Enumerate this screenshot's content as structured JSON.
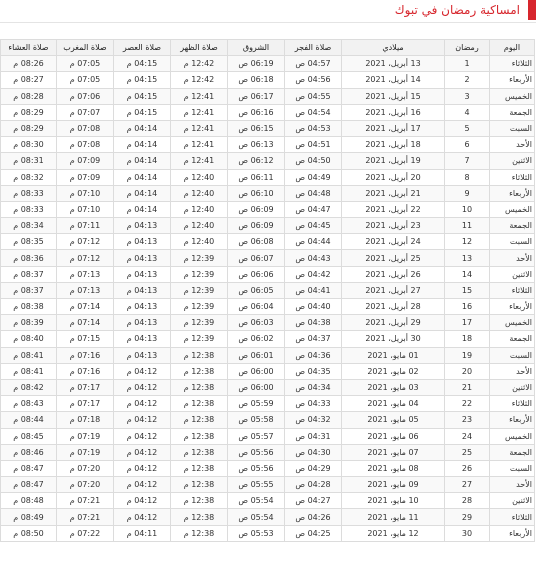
{
  "header": {
    "title": "امساكية رمضان في تبوك"
  },
  "table": {
    "columns": [
      "اليوم",
      "رمضان",
      "ميلادي",
      "صلاة الفجر",
      "الشروق",
      "صلاة الظهر",
      "صلاة العصر",
      "صلاة المغرب",
      "صلاة العشاء"
    ],
    "rows": [
      {
        "day": "الثلاثاء",
        "ramadan": "1",
        "gregorian": "13 أبريل، 2021",
        "fajr": "04:57 ص",
        "shuruq": "06:19 ص",
        "dhuhr": "12:42 م",
        "asr": "04:15 م",
        "maghrib": "07:05 م",
        "isha": "08:26 م"
      },
      {
        "day": "الأربعاء",
        "ramadan": "2",
        "gregorian": "14 أبريل، 2021",
        "fajr": "04:56 ص",
        "shuruq": "06:18 ص",
        "dhuhr": "12:42 م",
        "asr": "04:15 م",
        "maghrib": "07:05 م",
        "isha": "08:27 م"
      },
      {
        "day": "الخميس",
        "ramadan": "3",
        "gregorian": "15 أبريل، 2021",
        "fajr": "04:55 ص",
        "shuruq": "06:17 ص",
        "dhuhr": "12:41 م",
        "asr": "04:15 م",
        "maghrib": "07:06 م",
        "isha": "08:28 م"
      },
      {
        "day": "الجمعة",
        "ramadan": "4",
        "gregorian": "16 أبريل، 2021",
        "fajr": "04:54 ص",
        "shuruq": "06:16 ص",
        "dhuhr": "12:41 م",
        "asr": "04:15 م",
        "maghrib": "07:07 م",
        "isha": "08:29 م"
      },
      {
        "day": "السبت",
        "ramadan": "5",
        "gregorian": "17 أبريل، 2021",
        "fajr": "04:53 ص",
        "shuruq": "06:15 ص",
        "dhuhr": "12:41 م",
        "asr": "04:14 م",
        "maghrib": "07:08 م",
        "isha": "08:29 م"
      },
      {
        "day": "الأحد",
        "ramadan": "6",
        "gregorian": "18 أبريل، 2021",
        "fajr": "04:51 ص",
        "shuruq": "06:13 ص",
        "dhuhr": "12:41 م",
        "asr": "04:14 م",
        "maghrib": "07:08 م",
        "isha": "08:30 م"
      },
      {
        "day": "الاثنين",
        "ramadan": "7",
        "gregorian": "19 أبريل، 2021",
        "fajr": "04:50 ص",
        "shuruq": "06:12 ص",
        "dhuhr": "12:41 م",
        "asr": "04:14 م",
        "maghrib": "07:09 م",
        "isha": "08:31 م"
      },
      {
        "day": "الثلاثاء",
        "ramadan": "8",
        "gregorian": "20 أبريل، 2021",
        "fajr": "04:49 ص",
        "shuruq": "06:11 ص",
        "dhuhr": "12:40 م",
        "asr": "04:14 م",
        "maghrib": "07:09 م",
        "isha": "08:32 م"
      },
      {
        "day": "الأربعاء",
        "ramadan": "9",
        "gregorian": "21 أبريل، 2021",
        "fajr": "04:48 ص",
        "shuruq": "06:10 ص",
        "dhuhr": "12:40 م",
        "asr": "04:14 م",
        "maghrib": "07:10 م",
        "isha": "08:33 م"
      },
      {
        "day": "الخميس",
        "ramadan": "10",
        "gregorian": "22 أبريل، 2021",
        "fajr": "04:47 ص",
        "shuruq": "06:09 ص",
        "dhuhr": "12:40 م",
        "asr": "04:14 م",
        "maghrib": "07:10 م",
        "isha": "08:33 م"
      },
      {
        "day": "الجمعة",
        "ramadan": "11",
        "gregorian": "23 أبريل، 2021",
        "fajr": "04:45 ص",
        "shuruq": "06:09 ص",
        "dhuhr": "12:40 م",
        "asr": "04:13 م",
        "maghrib": "07:11 م",
        "isha": "08:34 م"
      },
      {
        "day": "السبت",
        "ramadan": "12",
        "gregorian": "24 أبريل، 2021",
        "fajr": "04:44 ص",
        "shuruq": "06:08 ص",
        "dhuhr": "12:40 م",
        "asr": "04:13 م",
        "maghrib": "07:12 م",
        "isha": "08:35 م"
      },
      {
        "day": "الأحد",
        "ramadan": "13",
        "gregorian": "25 أبريل، 2021",
        "fajr": "04:43 ص",
        "shuruq": "06:07 ص",
        "dhuhr": "12:39 م",
        "asr": "04:13 م",
        "maghrib": "07:12 م",
        "isha": "08:36 م"
      },
      {
        "day": "الاثنين",
        "ramadan": "14",
        "gregorian": "26 أبريل، 2021",
        "fajr": "04:42 ص",
        "shuruq": "06:06 ص",
        "dhuhr": "12:39 م",
        "asr": "04:13 م",
        "maghrib": "07:13 م",
        "isha": "08:37 م"
      },
      {
        "day": "الثلاثاء",
        "ramadan": "15",
        "gregorian": "27 أبريل، 2021",
        "fajr": "04:41 ص",
        "shuruq": "06:05 ص",
        "dhuhr": "12:39 م",
        "asr": "04:13 م",
        "maghrib": "07:13 م",
        "isha": "08:37 م"
      },
      {
        "day": "الأربعاء",
        "ramadan": "16",
        "gregorian": "28 أبريل، 2021",
        "fajr": "04:40 ص",
        "shuruq": "06:04 ص",
        "dhuhr": "12:39 م",
        "asr": "04:13 م",
        "maghrib": "07:14 م",
        "isha": "08:38 م"
      },
      {
        "day": "الخميس",
        "ramadan": "17",
        "gregorian": "29 أبريل، 2021",
        "fajr": "04:38 ص",
        "shuruq": "06:03 ص",
        "dhuhr": "12:39 م",
        "asr": "04:13 م",
        "maghrib": "07:14 م",
        "isha": "08:39 م"
      },
      {
        "day": "الجمعة",
        "ramadan": "18",
        "gregorian": "30 أبريل، 2021",
        "fajr": "04:37 ص",
        "shuruq": "06:02 ص",
        "dhuhr": "12:39 م",
        "asr": "04:13 م",
        "maghrib": "07:15 م",
        "isha": "08:40 م"
      },
      {
        "day": "السبت",
        "ramadan": "19",
        "gregorian": "01 مايو، 2021",
        "fajr": "04:36 ص",
        "shuruq": "06:01 ص",
        "dhuhr": "12:38 م",
        "asr": "04:13 م",
        "maghrib": "07:16 م",
        "isha": "08:41 م"
      },
      {
        "day": "الأحد",
        "ramadan": "20",
        "gregorian": "02 مايو، 2021",
        "fajr": "04:35 ص",
        "shuruq": "06:00 ص",
        "dhuhr": "12:38 م",
        "asr": "04:12 م",
        "maghrib": "07:16 م",
        "isha": "08:41 م"
      },
      {
        "day": "الاثنين",
        "ramadan": "21",
        "gregorian": "03 مايو، 2021",
        "fajr": "04:34 ص",
        "shuruq": "06:00 ص",
        "dhuhr": "12:38 م",
        "asr": "04:12 م",
        "maghrib": "07:17 م",
        "isha": "08:42 م"
      },
      {
        "day": "الثلاثاء",
        "ramadan": "22",
        "gregorian": "04 مايو، 2021",
        "fajr": "04:33 ص",
        "shuruq": "05:59 ص",
        "dhuhr": "12:38 م",
        "asr": "04:12 م",
        "maghrib": "07:17 م",
        "isha": "08:43 م"
      },
      {
        "day": "الأربعاء",
        "ramadan": "23",
        "gregorian": "05 مايو، 2021",
        "fajr": "04:32 ص",
        "shuruq": "05:58 ص",
        "dhuhr": "12:38 م",
        "asr": "04:12 م",
        "maghrib": "07:18 م",
        "isha": "08:44 م"
      },
      {
        "day": "الخميس",
        "ramadan": "24",
        "gregorian": "06 مايو، 2021",
        "fajr": "04:31 ص",
        "shuruq": "05:57 ص",
        "dhuhr": "12:38 م",
        "asr": "04:12 م",
        "maghrib": "07:19 م",
        "isha": "08:45 م"
      },
      {
        "day": "الجمعة",
        "ramadan": "25",
        "gregorian": "07 مايو، 2021",
        "fajr": "04:30 ص",
        "shuruq": "05:56 ص",
        "dhuhr": "12:38 م",
        "asr": "04:12 م",
        "maghrib": "07:19 م",
        "isha": "08:46 م"
      },
      {
        "day": "السبت",
        "ramadan": "26",
        "gregorian": "08 مايو، 2021",
        "fajr": "04:29 ص",
        "shuruq": "05:56 ص",
        "dhuhr": "12:38 م",
        "asr": "04:12 م",
        "maghrib": "07:20 م",
        "isha": "08:47 م"
      },
      {
        "day": "الأحد",
        "ramadan": "27",
        "gregorian": "09 مايو، 2021",
        "fajr": "04:28 ص",
        "shuruq": "05:55 ص",
        "dhuhr": "12:38 م",
        "asr": "04:12 م",
        "maghrib": "07:20 م",
        "isha": "08:47 م"
      },
      {
        "day": "الاثنين",
        "ramadan": "28",
        "gregorian": "10 مايو، 2021",
        "fajr": "04:27 ص",
        "shuruq": "05:54 ص",
        "dhuhr": "12:38 م",
        "asr": "04:12 م",
        "maghrib": "07:21 م",
        "isha": "08:48 م"
      },
      {
        "day": "الثلاثاء",
        "ramadan": "29",
        "gregorian": "11 مايو، 2021",
        "fajr": "04:26 ص",
        "shuruq": "05:54 ص",
        "dhuhr": "12:38 م",
        "asr": "04:12 م",
        "maghrib": "07:21 م",
        "isha": "08:49 م"
      },
      {
        "day": "الأربعاء",
        "ramadan": "30",
        "gregorian": "12 مايو، 2021",
        "fajr": "04:25 ص",
        "shuruq": "05:53 ص",
        "dhuhr": "12:38 م",
        "asr": "04:11 م",
        "maghrib": "07:22 م",
        "isha": "08:50 م"
      }
    ]
  }
}
